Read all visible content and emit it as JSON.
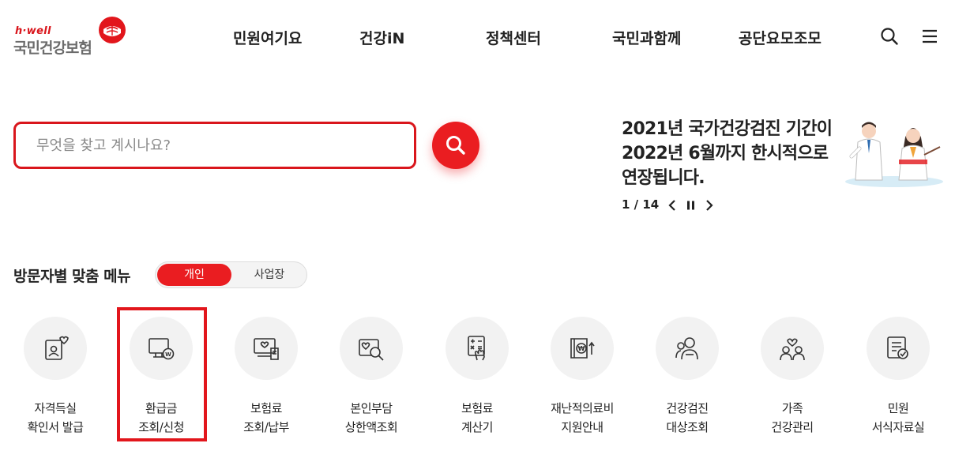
{
  "header": {
    "logo_sub": "h·well",
    "logo_main": "국민건강보험",
    "nav": [
      "민원여기요",
      "건강iN",
      "정책센터",
      "국민과함께",
      "공단요모조모"
    ],
    "icons": [
      "search-icon",
      "hamburger-menu-icon"
    ]
  },
  "search": {
    "placeholder": "무엇을 찾고 계시나요?",
    "value": "",
    "button_icon": "search-icon"
  },
  "notice": {
    "title": "2021년 국가건강검진 기간이 2022년 6월까지 한시적으로 연장됩니다.",
    "pager": "1 / 14",
    "controls": [
      "prev-icon",
      "pause-icon",
      "next-icon"
    ]
  },
  "visitor_menu": {
    "title": "방문자별 맞춤 메뉴",
    "toggle": [
      "개인",
      "사업장"
    ],
    "selected": "개인",
    "items": [
      {
        "line1": "자격득실",
        "line2": "확인서 발급",
        "icon": "certificate-icon"
      },
      {
        "line1": "환급금",
        "line2": "조회/신청",
        "icon": "refund-monitor-icon"
      },
      {
        "line1": "보험료",
        "line2": "조회/납부",
        "icon": "premium-payment-icon"
      },
      {
        "line1": "본인부담",
        "line2": "상한액조회",
        "icon": "out-of-pocket-search-icon"
      },
      {
        "line1": "보험료",
        "line2": "계산기",
        "icon": "calculator-icon"
      },
      {
        "line1": "재난적의료비",
        "line2": "지원안내",
        "icon": "medical-support-icon"
      },
      {
        "line1": "건강검진",
        "line2": "대상조회",
        "icon": "health-checkup-icon"
      },
      {
        "line1": "가족",
        "line2": "건강관리",
        "icon": "family-care-icon"
      },
      {
        "line1": "민원",
        "line2": "서식자료실",
        "icon": "forms-library-icon"
      }
    ]
  },
  "colors": {
    "accent": "#ea1d21",
    "highlight_border": "#e2161c",
    "circle_bg": "#f2f2f2"
  }
}
